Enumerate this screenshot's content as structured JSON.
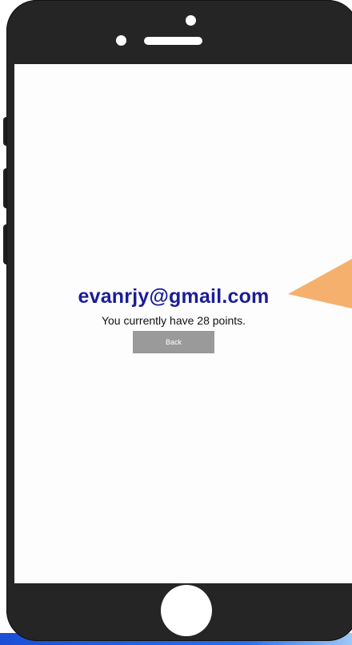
{
  "profile": {
    "email": "evanrjy@gmail.com",
    "points_message": "You currently have 28 points.",
    "back_label": "Back"
  },
  "colors": {
    "email_text": "#1b1d99",
    "button_bg": "#9a9a9a",
    "pointer": "#f6b06d",
    "device": "#252525"
  },
  "icons": {
    "pointer": "arrow-pointer-icon"
  }
}
